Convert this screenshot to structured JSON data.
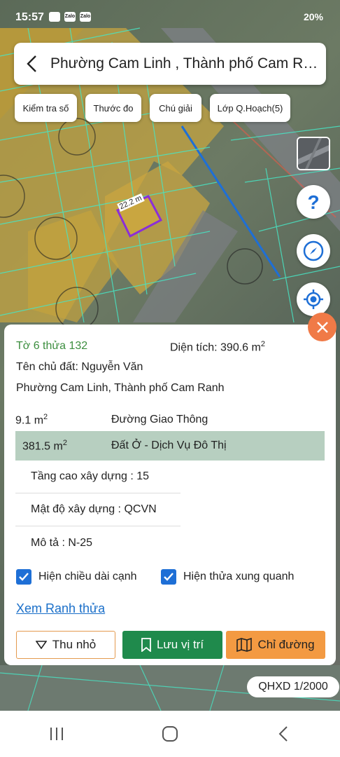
{
  "status_bar": {
    "time": "15:57",
    "notif_icons": [
      "image-icon",
      "Zalo",
      "Zalo"
    ],
    "right_text": "20%"
  },
  "header": {
    "title": "Phường Cam Linh , Thành phố Cam Ranh"
  },
  "chips": [
    {
      "label": "Kiểm tra số"
    },
    {
      "label": "Thước đo"
    },
    {
      "label": "Chú giải"
    },
    {
      "label": "Lớp Q.Hoạch(5)"
    }
  ],
  "map": {
    "dimension_label": "22.2 m"
  },
  "parcel": {
    "title": "Tờ 6 thửa 132",
    "area_label": "Diện tích: 390.6 m",
    "area_sup": "2",
    "owner": "Tên chủ đất: Nguyễn Văn",
    "address": "Phường Cam Linh, Thành phố Cam Ranh",
    "land_use": [
      {
        "area": "9.1 m",
        "sup": "2",
        "type": "Đường Giao Thông"
      },
      {
        "area": "381.5 m",
        "sup": "2",
        "type": "Đất Ở - Dịch Vụ Đô Thị"
      }
    ],
    "details": [
      {
        "text": "Tầng cao xây dựng : 15"
      },
      {
        "text": "Mật độ xây dựng : QCVN"
      },
      {
        "text": "Mô tả : N-25"
      }
    ],
    "checkbox_edge_length": "Hiện chiều dài cạnh",
    "checkbox_neighbors": "Hiện thửa xung quanh",
    "link_boundary": "Xem Ranh thửa",
    "btn_collapse": "Thu nhỏ",
    "btn_save": "Lưu vị trí",
    "btn_direction": "Chỉ đường"
  },
  "scale_badge": "QHXD 1/2000",
  "colors": {
    "green": "#1f8a4c",
    "orange": "#f39a42",
    "accent_blue": "#1e6fd6",
    "close_orange": "#f07a47"
  }
}
